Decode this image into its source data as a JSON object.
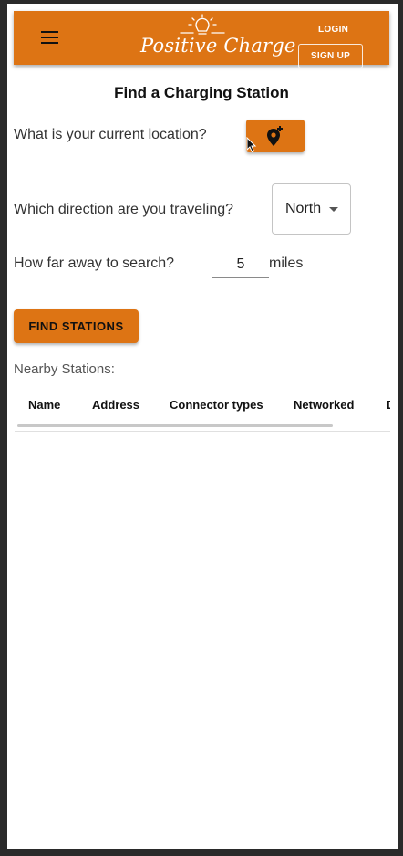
{
  "header": {
    "brand": "Positive Charge",
    "login_label": "LOGIN",
    "signup_label": "SIGN UP"
  },
  "page": {
    "title": "Find a Charging Station"
  },
  "form": {
    "location_question": "What is your current location?",
    "direction_question": "Which direction are you traveling?",
    "direction_value": "North",
    "distance_question": "How far away to search?",
    "distance_value": "5",
    "distance_unit": "miles",
    "find_label": "FIND STATIONS"
  },
  "results": {
    "heading": "Nearby Stations:",
    "columns": [
      "Name",
      "Address",
      "Connector types",
      "Networked",
      "D"
    ],
    "rows": []
  },
  "icons": {
    "menu": "hamburger-menu-icon",
    "location": "add-location-pin-icon",
    "logo": "lightbulb-logo-icon",
    "dropdown": "caret-down-icon",
    "cursor": "mouse-pointer-icon"
  },
  "colors": {
    "accent": "#dd7414",
    "background": "#ffffff",
    "outer": "#2a2a2a"
  }
}
